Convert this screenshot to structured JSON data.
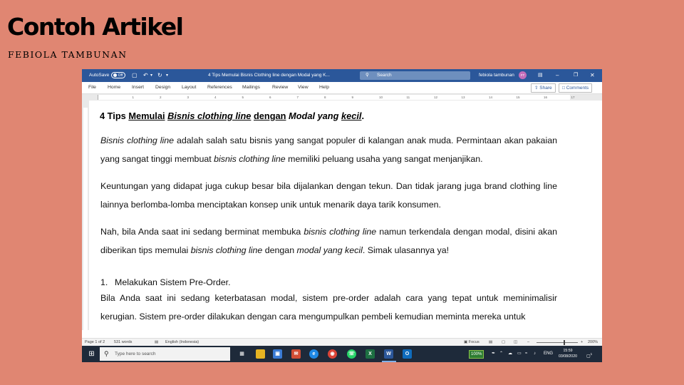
{
  "slide": {
    "title": "Contoh Artikel",
    "author": "FEBIOLA TAMBUNAN"
  },
  "word": {
    "autosave_label": "AutoSave",
    "autosave_state": "Off",
    "doc_title": "4 Tips Memulai Bisnis Clothing line dengan Modal yang K...",
    "search_placeholder": "Search",
    "user_name": "febiola tambunan",
    "user_initials": "FT",
    "menu": [
      "File",
      "Home",
      "Insert",
      "Design",
      "Layout",
      "References",
      "Mailings",
      "Review",
      "View",
      "Help"
    ],
    "share_label": "Share",
    "comments_label": "Comments",
    "ruler_marks": [
      "1",
      "2",
      "3",
      "4",
      "5",
      "6",
      "7",
      "8",
      "9",
      "10",
      "11",
      "12",
      "13",
      "14",
      "15",
      "16",
      "17"
    ]
  },
  "document": {
    "title_parts": [
      "4 Tips ",
      "Memulai",
      " ",
      "Bisnis clothing line",
      " ",
      "dengan",
      " ",
      "Modal yang",
      " ",
      "kecil",
      "."
    ],
    "para1_parts": [
      "Bisnis",
      " clothing line",
      " adalah salah satu bisnis yang sangat populer di kalangan anak muda. Permintaan akan pakaian yang sangat tinggi membuat ",
      "bisnis",
      " clothing line",
      " memiliki peluang usaha yang sangat menjanjikan."
    ],
    "para2": "Keuntungan yang didapat juga cukup besar bila dijalankan dengan tekun. Dan tidak jarang juga brand clothing line lainnya berlomba-lomba menciptakan konsep unik untuk menarik daya tarik konsumen.",
    "para3_parts": [
      "Nah, bila Anda saat ini sedang berminat membuka ",
      "bisnis",
      " clothing line",
      " namun terkendala dengan modal, disini akan diberikan tips memulai ",
      "bisnis",
      " clothing line",
      " dengan ",
      "modal yang kecil",
      ". Simak ulasannya ya!"
    ],
    "list_number": "1.",
    "list_text": "Melakukan Sistem Pre-Order.",
    "para4": "Bila Anda saat ini sedang keterbatasan modal, sistem pre-order adalah cara yang tepat untuk meminimalisir kerugian. Sistem pre-order dilakukan dengan cara mengumpulkan pembeli kemudian meminta mereka untuk"
  },
  "status": {
    "page": "Page 1 of 2",
    "words": "531 words",
    "language": "English (Indonesia)",
    "focus": "Focus",
    "zoom": "200%"
  },
  "taskbar": {
    "search_placeholder": "Type here to search",
    "battery": "100%",
    "lang": "ENG",
    "time": "15:59",
    "date": "03/08/2020",
    "notification_count": "1"
  },
  "colors": {
    "slide_bg": "#E08672",
    "word_blue": "#2B579A",
    "taskbar": "#1E2A3A"
  }
}
